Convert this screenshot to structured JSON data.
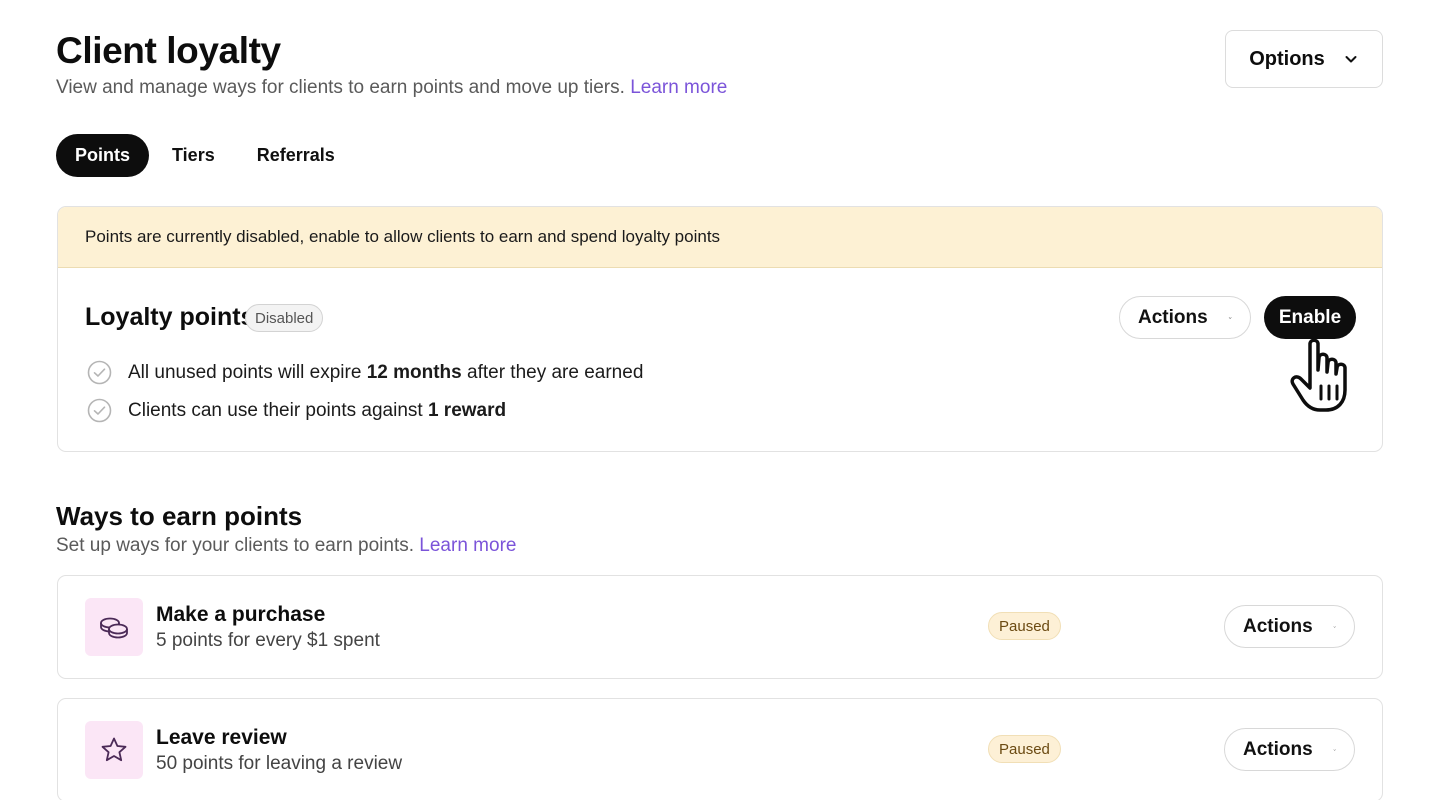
{
  "header": {
    "title": "Client loyalty",
    "subtitle": "View and manage ways for clients to earn points and move up tiers.",
    "learn_more": "Learn more",
    "options_label": "Options"
  },
  "tabs": [
    {
      "label": "Points",
      "active": true
    },
    {
      "label": "Tiers",
      "active": false
    },
    {
      "label": "Referrals",
      "active": false
    }
  ],
  "loyalty": {
    "banner": "Points are currently disabled, enable to allow clients to earn and spend loyalty points",
    "title": "Loyalty points",
    "status_badge": "Disabled",
    "actions_label": "Actions",
    "enable_label": "Enable",
    "features": [
      {
        "prefix": "All unused points will expire ",
        "bold": "12 months",
        "suffix": " after they are earned"
      },
      {
        "prefix": "Clients can use their points against ",
        "bold": "1 reward",
        "suffix": ""
      }
    ]
  },
  "earn": {
    "title": "Ways to earn points",
    "subtitle": "Set up ways for your clients to earn points.",
    "learn_more": "Learn more",
    "items": [
      {
        "name": "Make a purchase",
        "description": "5 points for every $1 spent",
        "status": "Paused",
        "actions_label": "Actions",
        "icon": "coins-icon"
      },
      {
        "name": "Leave review",
        "description": "50 points for leaving a review",
        "status": "Paused",
        "actions_label": "Actions",
        "icon": "star-icon"
      }
    ]
  },
  "colors": {
    "accent_link": "#7b54d9",
    "banner_bg": "#fdf1d4",
    "icon_tile_bg": "#fbe6f6",
    "paused_badge_bg": "#fdf0d6",
    "primary_button": "#0d0d0d"
  }
}
